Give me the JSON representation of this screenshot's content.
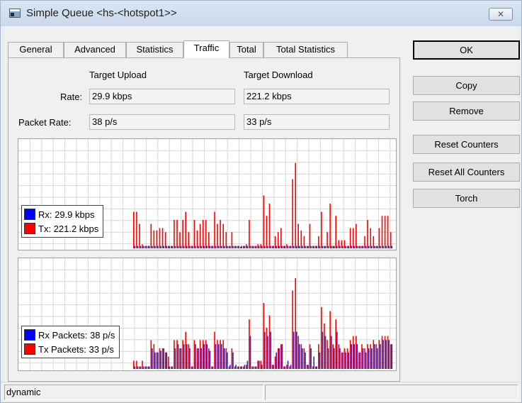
{
  "window": {
    "title": "Simple Queue <hs-<hotspot1>>",
    "close_glyph": "✕"
  },
  "tabs": [
    "General",
    "Advanced",
    "Statistics",
    "Traffic",
    "Total",
    "Total Statistics"
  ],
  "active_tab": "Traffic",
  "traffic": {
    "col_upload": "Target Upload",
    "col_download": "Target Download",
    "rate_label": "Rate:",
    "rate_upload": "29.9 kbps",
    "rate_download": "221.2 kbps",
    "packet_rate_label": "Packet Rate:",
    "packet_rate_upload": "38 p/s",
    "packet_rate_download": "33 p/s"
  },
  "graphs": {
    "rate": {
      "legend": [
        {
          "label": "Rx:  29.9 kbps",
          "color": "#0000ff"
        },
        {
          "label": "Tx:  221.2 kbps",
          "color": "#ff0000"
        }
      ],
      "rx": [
        3,
        3,
        3,
        3,
        3,
        3,
        3,
        3,
        3,
        3,
        3,
        3,
        3,
        3,
        3,
        3,
        3,
        3,
        3,
        3,
        3,
        3,
        3,
        3,
        3,
        3,
        3,
        3,
        3,
        3,
        3,
        3,
        3,
        3,
        3,
        3,
        3,
        3,
        3,
        3,
        3,
        3,
        3,
        3,
        3,
        3,
        3,
        3,
        3,
        3,
        3,
        3,
        3,
        3,
        3,
        3,
        3,
        3,
        3,
        3,
        3,
        3,
        3,
        3,
        3,
        3,
        3,
        3,
        3,
        3,
        3,
        3,
        3,
        3,
        3,
        3,
        3,
        3,
        3,
        3,
        3,
        3,
        3,
        3,
        3,
        3,
        3,
        3,
        3,
        3
      ],
      "tx": [
        45,
        45,
        30,
        5,
        3,
        3,
        30,
        22,
        22,
        25,
        25,
        20,
        3,
        3,
        35,
        35,
        20,
        35,
        45,
        20,
        3,
        35,
        22,
        30,
        35,
        35,
        20,
        3,
        45,
        30,
        35,
        30,
        20,
        3,
        20,
        3,
        3,
        2,
        3,
        5,
        35,
        3,
        3,
        5,
        5,
        65,
        40,
        55,
        3,
        15,
        20,
        25,
        3,
        5,
        3,
        85,
        105,
        30,
        22,
        15,
        3,
        30,
        3,
        3,
        15,
        45,
        3,
        20,
        55,
        3,
        40,
        10,
        10,
        10,
        3,
        25,
        25,
        30,
        3,
        3,
        15,
        35,
        25,
        15,
        3,
        25,
        40,
        40,
        40,
        20
      ]
    },
    "packets": {
      "legend": [
        {
          "label": "Rx Packets:  38 p/s",
          "color": "#0000ff"
        },
        {
          "label": "Tx Packets:  33 p/s",
          "color": "#ff0000"
        }
      ],
      "rx": [
        3,
        3,
        3,
        3,
        3,
        3,
        25,
        20,
        20,
        22,
        25,
        20,
        3,
        3,
        25,
        30,
        25,
        30,
        30,
        25,
        3,
        30,
        25,
        25,
        30,
        30,
        22,
        3,
        30,
        30,
        30,
        25,
        20,
        5,
        20,
        5,
        3,
        3,
        5,
        10,
        40,
        3,
        3,
        10,
        5,
        45,
        40,
        45,
        5,
        20,
        25,
        30,
        3,
        10,
        5,
        45,
        45,
        30,
        25,
        20,
        5,
        25,
        15,
        3,
        20,
        45,
        40,
        25,
        40,
        25,
        45,
        25,
        20,
        20,
        20,
        30,
        30,
        30,
        20,
        25,
        20,
        25,
        25,
        30,
        25,
        30,
        35,
        35,
        35,
        30
      ],
      "tx": [
        10,
        10,
        3,
        10,
        3,
        3,
        35,
        30,
        20,
        25,
        25,
        20,
        15,
        3,
        35,
        35,
        25,
        35,
        45,
        30,
        3,
        35,
        25,
        35,
        35,
        35,
        25,
        3,
        45,
        35,
        35,
        35,
        25,
        3,
        25,
        3,
        3,
        3,
        3,
        5,
        60,
        3,
        3,
        10,
        10,
        80,
        50,
        65,
        5,
        15,
        25,
        30,
        3,
        5,
        3,
        95,
        110,
        40,
        30,
        25,
        5,
        30,
        3,
        3,
        30,
        75,
        55,
        35,
        70,
        30,
        60,
        30,
        20,
        25,
        25,
        35,
        40,
        40,
        20,
        30,
        25,
        30,
        30,
        35,
        30,
        35,
        40,
        40,
        40,
        30
      ]
    }
  },
  "buttons": [
    "OK",
    "Copy",
    "Remove",
    "Reset Counters",
    "Reset All Counters",
    "Torch"
  ],
  "status": {
    "left": "dynamic",
    "right": ""
  }
}
